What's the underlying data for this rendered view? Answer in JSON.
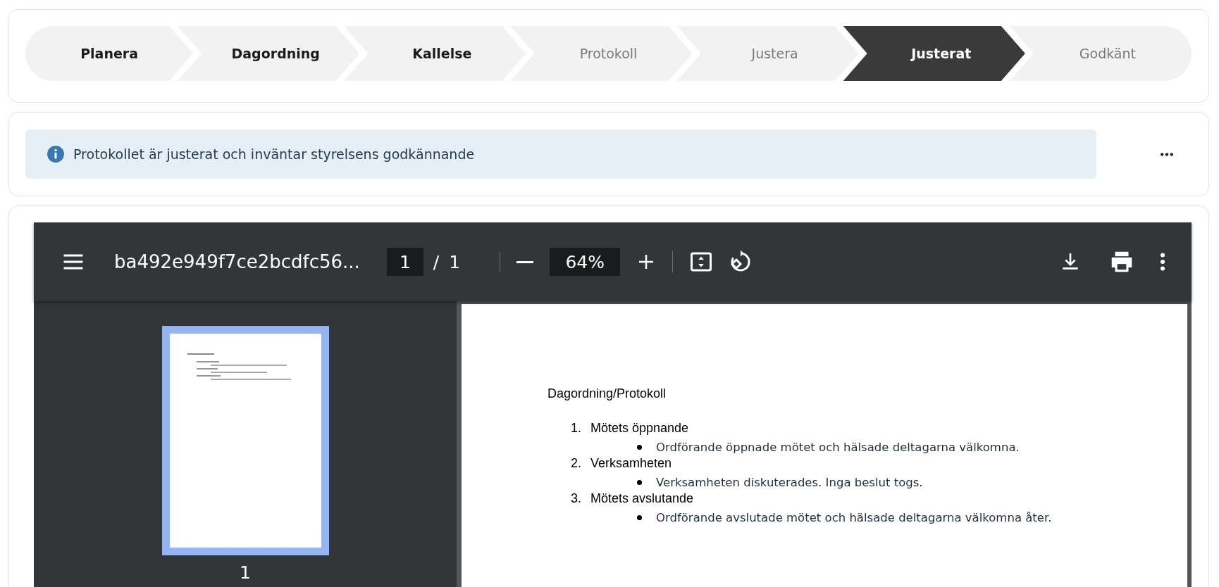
{
  "stepper": {
    "steps": [
      {
        "label": "Planera",
        "completed": true,
        "selected": false
      },
      {
        "label": "Dagordning",
        "completed": true,
        "selected": false
      },
      {
        "label": "Kallelse",
        "completed": true,
        "selected": false
      },
      {
        "label": "Protokoll",
        "completed": false,
        "selected": false
      },
      {
        "label": "Justera",
        "completed": false,
        "selected": false
      },
      {
        "label": "Justerat",
        "completed": false,
        "selected": true
      },
      {
        "label": "Godkänt",
        "completed": false,
        "selected": false
      }
    ]
  },
  "alert": {
    "kind": "info",
    "message": "Protokollet är justerat och inväntar styrelsens godkännande"
  },
  "pdf_viewer": {
    "toolbar": {
      "title": "ba492e949f7ce2bcdfc56...",
      "page": "1",
      "separator": "/",
      "total_pages": "1",
      "zoom": "64%"
    },
    "thumbnails": [
      {
        "label": "1",
        "selected": true
      }
    ],
    "document": {
      "heading": "Dagordning/Protokoll",
      "items": [
        {
          "number": "1.",
          "title": "Mötets öppnande",
          "notes": [
            "Ordförande öppnade mötet och hälsade deltagarna välkomna."
          ]
        },
        {
          "number": "2.",
          "title": "Verksamheten",
          "notes": [
            "Verksamheten diskuterades. Inga beslut togs."
          ]
        },
        {
          "number": "3.",
          "title": "Mötets avslutande",
          "notes": [
            "Ordförande avslutade mötet och hälsade deltagarna välkomna åter."
          ]
        }
      ]
    }
  }
}
